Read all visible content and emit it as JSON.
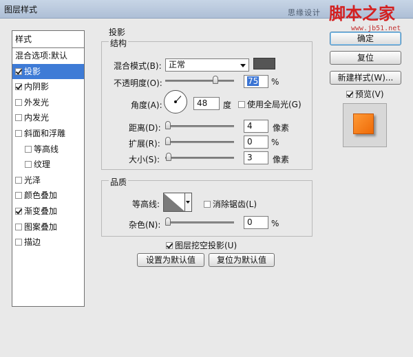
{
  "window": {
    "title": "图层样式",
    "watermark_text": "思缘设计",
    "watermark_logo": "脚本之家",
    "watermark_url": "www.jb51.net"
  },
  "styles_panel": {
    "header": "样式",
    "items": [
      {
        "label": "混合选项:默认",
        "has_checkbox": false,
        "checked": false,
        "sub": false,
        "active": false
      },
      {
        "label": "投影",
        "has_checkbox": true,
        "checked": true,
        "sub": false,
        "active": true
      },
      {
        "label": "内阴影",
        "has_checkbox": true,
        "checked": true,
        "sub": false,
        "active": false
      },
      {
        "label": "外发光",
        "has_checkbox": true,
        "checked": false,
        "sub": false,
        "active": false
      },
      {
        "label": "内发光",
        "has_checkbox": true,
        "checked": false,
        "sub": false,
        "active": false
      },
      {
        "label": "斜面和浮雕",
        "has_checkbox": true,
        "checked": false,
        "sub": false,
        "active": false
      },
      {
        "label": "等高线",
        "has_checkbox": true,
        "checked": false,
        "sub": true,
        "active": false
      },
      {
        "label": "纹理",
        "has_checkbox": true,
        "checked": false,
        "sub": true,
        "active": false
      },
      {
        "label": "光泽",
        "has_checkbox": true,
        "checked": false,
        "sub": false,
        "active": false
      },
      {
        "label": "颜色叠加",
        "has_checkbox": true,
        "checked": false,
        "sub": false,
        "active": false
      },
      {
        "label": "渐变叠加",
        "has_checkbox": true,
        "checked": true,
        "sub": false,
        "active": false
      },
      {
        "label": "图案叠加",
        "has_checkbox": true,
        "checked": false,
        "sub": false,
        "active": false
      },
      {
        "label": "描边",
        "has_checkbox": true,
        "checked": false,
        "sub": false,
        "active": false
      }
    ]
  },
  "drop_shadow": {
    "section_title": "投影",
    "structure": {
      "title": "结构",
      "blend_mode_label": "混合模式(B):",
      "blend_mode_value": "正常",
      "shadow_color": "#555555",
      "opacity_label": "不透明度(O):",
      "opacity_value": "75",
      "opacity_unit": "%",
      "angle_label": "角度(A):",
      "angle_value": "48",
      "angle_unit": "度",
      "global_light_label": "使用全局光(G)",
      "global_light_checked": false,
      "distance_label": "距离(D):",
      "distance_value": "4",
      "distance_unit": "像素",
      "spread_label": "扩展(R):",
      "spread_value": "0",
      "spread_unit": "%",
      "size_label": "大小(S):",
      "size_value": "3",
      "size_unit": "像素"
    },
    "quality": {
      "title": "品质",
      "contour_label": "等高线:",
      "antialias_label": "消除锯齿(L)",
      "antialias_checked": false,
      "noise_label": "杂色(N):",
      "noise_value": "0",
      "noise_unit": "%"
    },
    "knockout_label": "图层挖空投影(U)",
    "knockout_checked": true,
    "make_default_label": "设置为默认值",
    "reset_default_label": "复位为默认值"
  },
  "actions": {
    "ok_label": "确定",
    "reset_label": "复位",
    "new_style_label": "新建样式(W)...",
    "preview_label": "预览(V)",
    "preview_checked": true
  }
}
